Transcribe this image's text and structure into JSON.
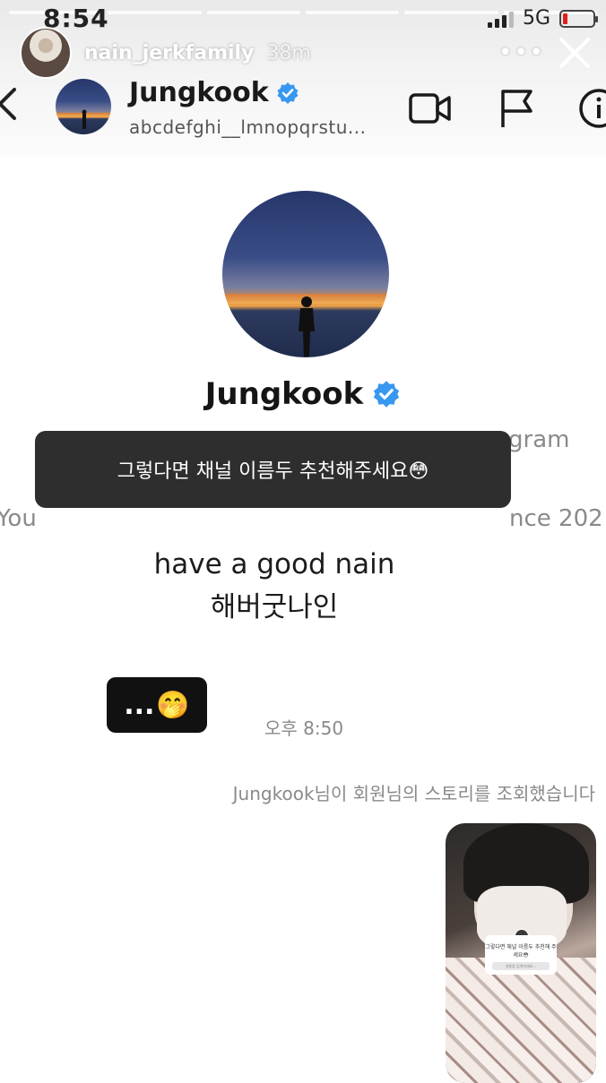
{
  "status": {
    "time": "8:54",
    "network": "5G"
  },
  "story": {
    "username": "nain_jerkfamily",
    "age": "38m"
  },
  "dm": {
    "name": "Jungkook",
    "subtitle": "abcdefghi__lmnopqrstu..."
  },
  "profile": {
    "name": "Jungkook",
    "faded_right": "gram",
    "faded_left": "You",
    "faded_right2": "nce 202"
  },
  "caption": "그렇다면 채널 이름두 추천해주세요😳",
  "messages": {
    "line1": "have a good nain",
    "line2": "해버굿나인",
    "bubble_text": "...",
    "bubble_emoji": "🤭",
    "time": "오후 8:50",
    "seen": "Jungkook님이 회원님의 스토리를 조회했습니다"
  },
  "thumbnail": {
    "sticker_text": "그렇다면 채널 이름두 추천해 주세요😳",
    "sticker_field": "내용을 입력하세요..."
  },
  "icons": [
    "back-chevron-icon",
    "video-call-icon",
    "flag-icon",
    "info-icon",
    "close-icon",
    "more-icon",
    "verified-badge-icon"
  ]
}
